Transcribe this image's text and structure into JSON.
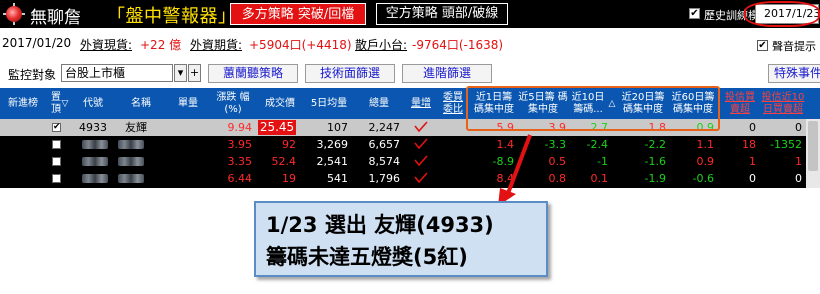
{
  "app": {
    "title": "無聊詹",
    "subtitle": "「盤中警報器」",
    "long_button": "多方策略 突破/回檔",
    "short_button": "空方策略 頭部/破線",
    "history_mode_label": "歷史訓練模式",
    "history_checked": "✔",
    "date": "2017/1/23"
  },
  "info": {
    "date": "2017/01/20",
    "spot_label": "外資現貨:",
    "spot_value": "+22 億",
    "futures_label": "外資期貨:",
    "futures_value": "+5904口(+4418)",
    "retail_label": "散戶小台:",
    "retail_value": "-9764口(-1638)",
    "sound_label": "聲音提示",
    "sound_checked": "✔"
  },
  "controls": {
    "monitor_label": "監控對象",
    "market_select": "台股上市櫃",
    "btn_down": "▾",
    "btn_plus": "+",
    "btn_orchid": "蕙蘭聽策略",
    "btn_tech": "技術面篩選",
    "btn_advanced": "進階篩選",
    "btn_special": "特殊事件"
  },
  "table": {
    "headers": {
      "new": "新進榜",
      "pin": "置頂",
      "pin_sort": "▽",
      "code": "代號",
      "name": "名稱",
      "volume": "單量",
      "change_pct": "漲跌 幅 (%)",
      "price": "成交價",
      "avg5": "5日均量",
      "total": "總量",
      "trend": "量增",
      "ratio": "委買 委比",
      "c1": "近1日籌 碼集中度",
      "c5": "近5日籌 碼集中度",
      "c10": "近10日 籌碼...",
      "c10_sort": "△",
      "c20": "近20日籌 碼集中度",
      "c60": "近60日籌 碼集中度",
      "trust": "投信買 賣超",
      "trust10": "投信近10 日買賣超"
    },
    "rows": [
      {
        "pin": "✔",
        "code": "4933",
        "name": "友輝",
        "change": "9.94",
        "price": "25.45",
        "avg5": "107",
        "total": "2,247",
        "c1": "5.9",
        "c5": "3.9",
        "c10": "2.7",
        "c20": "1.8",
        "c60": "0.9",
        "trust": "0",
        "trust10": "0"
      },
      {
        "pin": "",
        "code": "",
        "name": "",
        "change": "3.95",
        "price": "92",
        "avg5": "3,269",
        "total": "6,657",
        "c1": "1.4",
        "c5": "-3.3",
        "c10": "-2.4",
        "c20": "-2.2",
        "c60": "1.1",
        "trust": "18",
        "trust10": "-1352"
      },
      {
        "pin": "",
        "code": "",
        "name": "",
        "change": "3.35",
        "price": "52.4",
        "avg5": "2,541",
        "total": "8,574",
        "c1": "-8.9",
        "c5": "0.5",
        "c10": "-1",
        "c20": "-1.6",
        "c60": "0.9",
        "trust": "1",
        "trust10": "1"
      },
      {
        "pin": "",
        "code": "",
        "name": "",
        "change": "6.44",
        "price": "19",
        "avg5": "541",
        "total": "1,796",
        "c1": "8.4",
        "c5": "0.8",
        "c10": "0.1",
        "c20": "-1.9",
        "c60": "-0.6",
        "trust": "0",
        "trust10": "0"
      }
    ]
  },
  "annotation": {
    "line1": "1/23 選出 友輝(4933)",
    "line2": "籌碼未達五燈獎(5紅)"
  },
  "colors": {
    "accent_red": "#e31111",
    "header_blue": "#0a56b0",
    "highlight_orange": "#e8621a",
    "note_bg": "#cfe0f3"
  }
}
